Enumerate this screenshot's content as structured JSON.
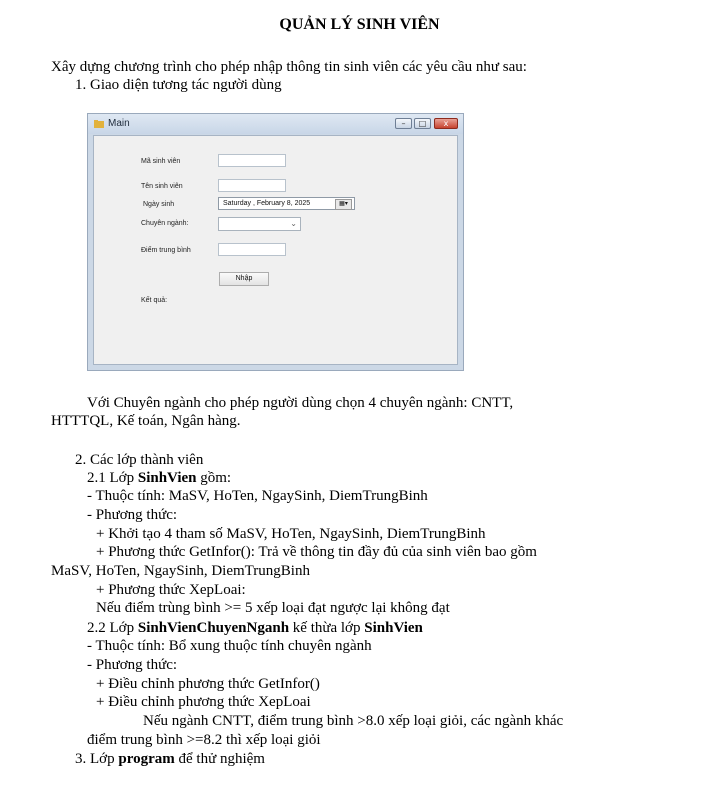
{
  "title": "QUẢN LÝ SINH VIÊN",
  "intro": "Xây dựng chương trình cho phép nhập thông tin sinh viên các yêu cầu như sau:",
  "item1": "1.  Giao diện tương tác người dùng",
  "window": {
    "title": "Main",
    "labels": {
      "masv": "Mã sinh viên",
      "ten": "Tên sinh viên",
      "ngaysinh": "Ngày sinh",
      "chuyennganh": "Chuyên ngành:",
      "diem": "Điểm trung bình",
      "ketqua": "Kết quả:"
    },
    "date_value": "Saturday   ,   February    8, 2025",
    "button": "Nhập",
    "min_glyph": "–",
    "max_glyph": "□",
    "close_glyph": "x"
  },
  "para1_line1": "Với Chuyên ngành cho phép người dùng chọn 4 chuyên ngành: CNTT,",
  "para1_line2": "HTTTQL, Kế toán, Ngân hàng.",
  "item2": "2.  Các lớp thành viên",
  "s21_pre": "2.1 Lớp ",
  "s21_bold": "SinhVien",
  "s21_post": " gồm:",
  "s21_attr": "- Thuộc tính: MaSV, HoTen, NgaySinh, DiemTrungBinh",
  "s21_methods": "- Phương thức:",
  "s21_m1": "+ Khởi tạo 4 tham số MaSV, HoTen, NgaySinh, DiemTrungBinh",
  "s21_m2_line1": "+ Phương thức GetInfor(): Trả về thông tin đầy đủ của sinh viên bao gồm",
  "s21_m2_line2": "MaSV, HoTen, NgaySinh, DiemTrungBinh",
  "s21_m3": "+ Phương thức XepLoai:",
  "s21_m3_desc": "Nếu điểm trùng bình >= 5 xếp loại đạt ngược lại không đạt",
  "s22_pre": "2.2 Lớp ",
  "s22_bold1": "SinhVienChuyenNganh",
  "s22_mid": " kế thừa lớp ",
  "s22_bold2": "SinhVien",
  "s22_attr": "- Thuộc tính: Bổ xung thuộc tính chuyên ngành",
  "s22_methods": "- Phương thức:",
  "s22_m1": "+ Điều chỉnh phương thức GetInfor()",
  "s22_m2": "+ Điều chỉnh phương thức XepLoai",
  "s22_m2_desc_line1": "Nếu ngành CNTT, điểm trung bình  >8.0 xếp loại giỏi, các ngành khác",
  "s22_m2_desc_line2": "điểm trung bình >=8.2 thì xếp loại giỏi",
  "item3_pre": "3.  Lớp ",
  "item3_bold": "program",
  "item3_post": " để thử nghiệm"
}
